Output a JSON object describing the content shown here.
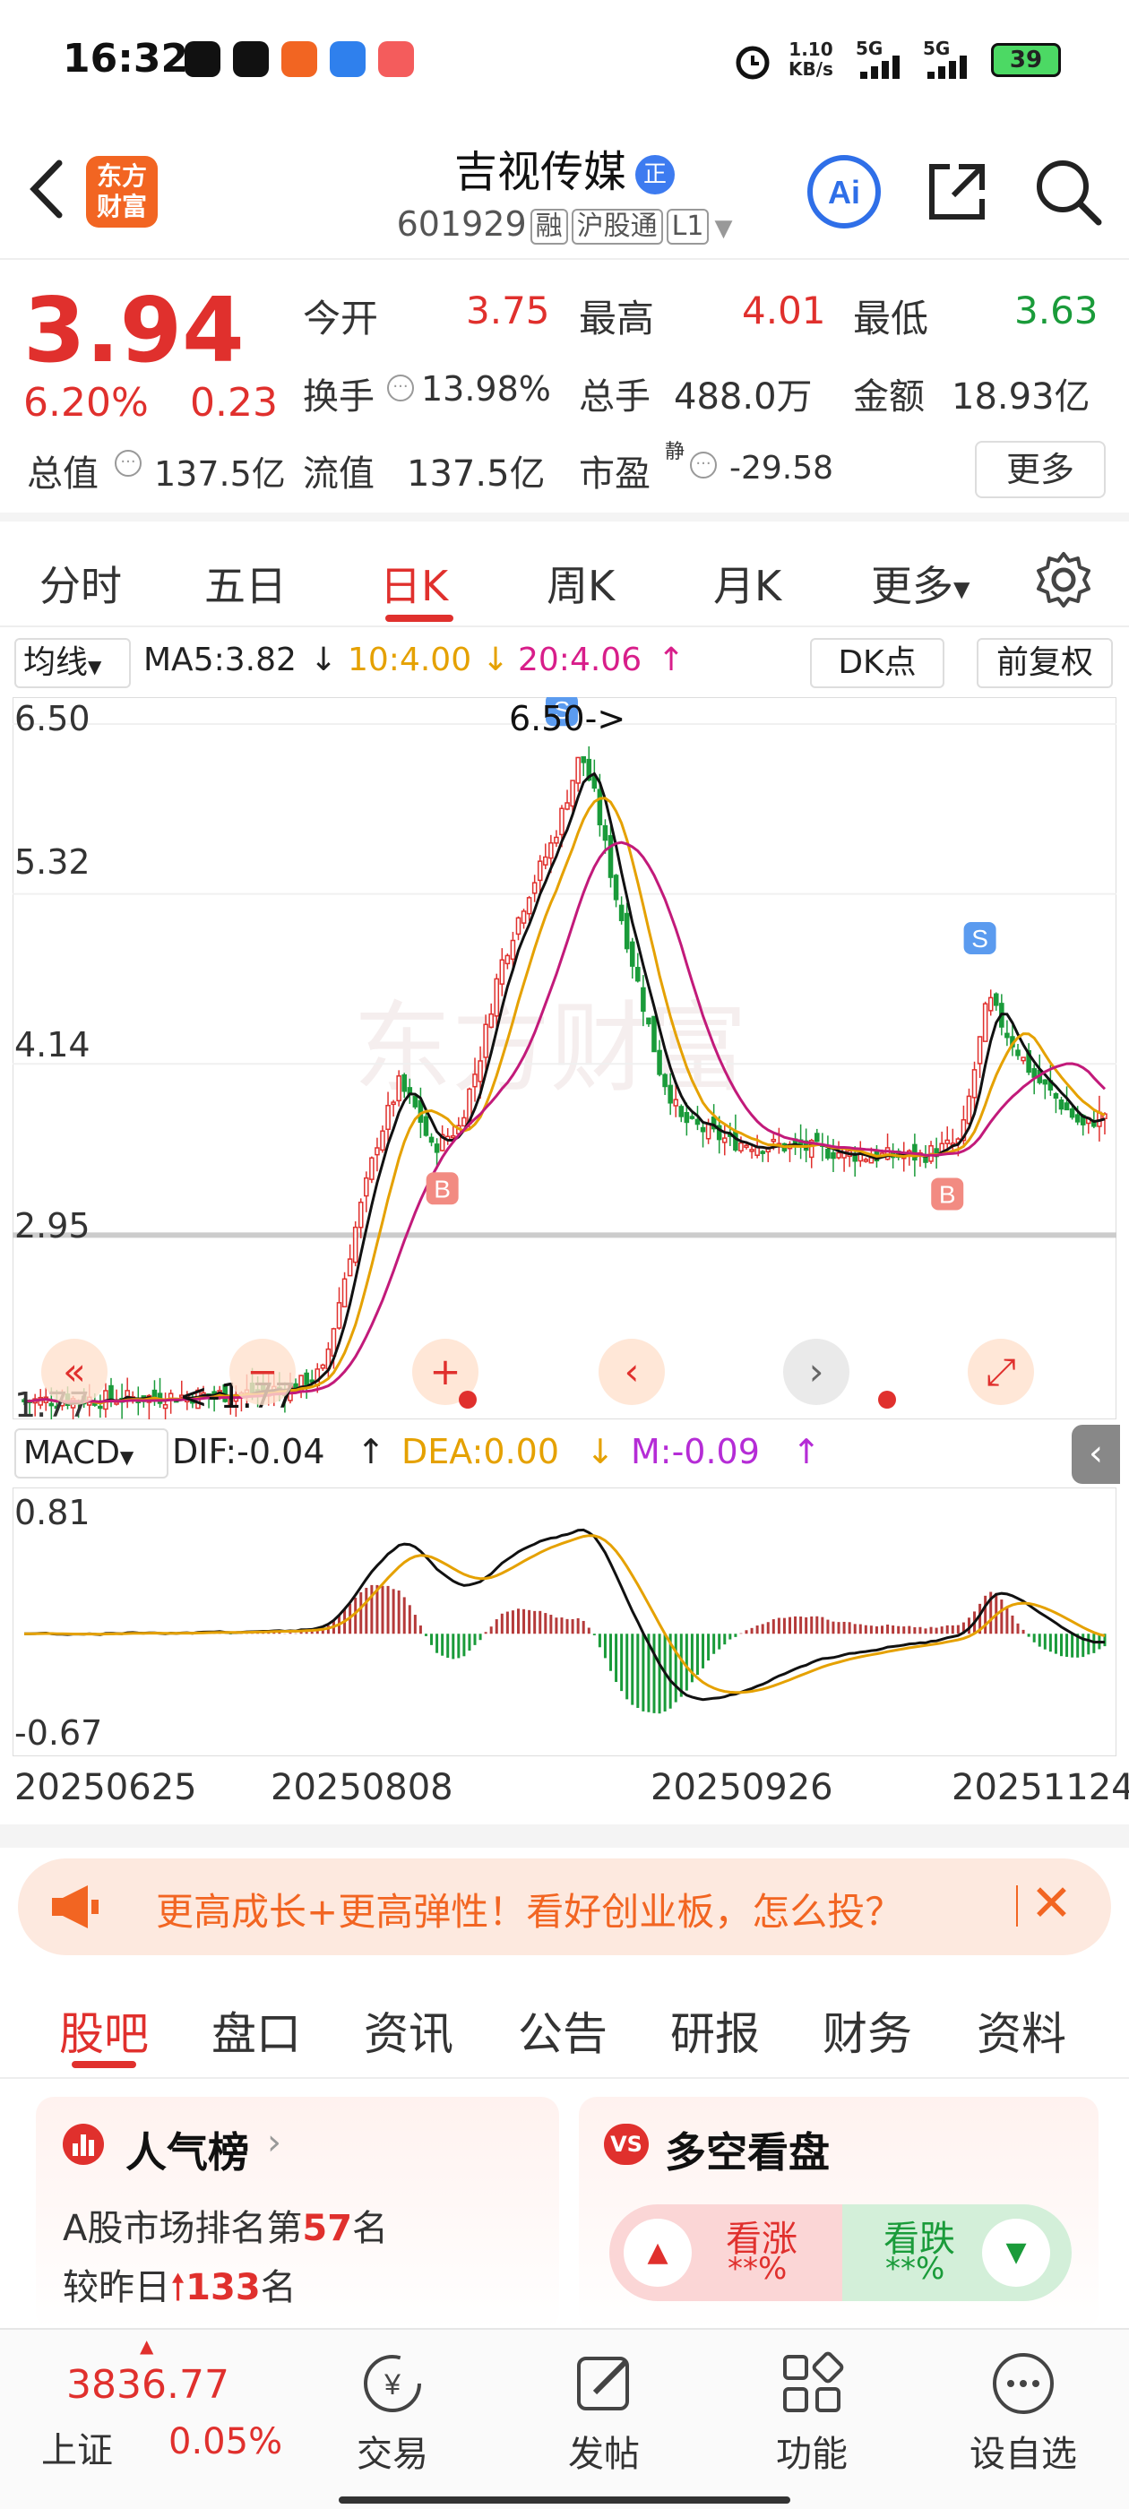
{
  "status_bar": {
    "time": "16:32",
    "net_speed": "1.10",
    "net_unit": "KB/s",
    "sig1": "5G",
    "sig2": "5G",
    "battery": "39"
  },
  "header": {
    "logo_line1": "东方",
    "logo_line2": "财富",
    "title": "吉视传媒",
    "title_badge": "正",
    "code": "601929",
    "tags": [
      "融",
      "沪股通",
      "L1"
    ]
  },
  "quote": {
    "price": "3.94",
    "change_pct": "6.20%",
    "change": "0.23",
    "open_label": "今开",
    "open": "3.75",
    "high_label": "最高",
    "high": "4.01",
    "low_label": "最低",
    "low": "3.63",
    "turnover_label": "换手",
    "turnover": "13.98%",
    "volume_label": "总手",
    "volume": "488.0万",
    "amount_label": "金额",
    "amount": "18.93亿",
    "mktcap_label": "总值",
    "mktcap": "137.5亿",
    "float_label": "流值",
    "float": "137.5亿",
    "pe_label": "市盈",
    "pe_sup": "静",
    "pe": "-29.58",
    "more": "更多"
  },
  "tabs": [
    "分时",
    "五日",
    "日K",
    "周K",
    "月K",
    "更多"
  ],
  "active_tab": "日K",
  "ma_bar": {
    "selector": "均线",
    "ma5": "MA5:3.82",
    "ma10": "10:4.00",
    "ma20": "20:4.06",
    "dk": "DK点",
    "fq": "前复权"
  },
  "kline": {
    "y_labels": [
      "6.50",
      "5.32",
      "4.14",
      "2.95",
      "1.77"
    ],
    "peak_label": "6.50->",
    "low_label": "<-1.77",
    "watermark": "东方财富"
  },
  "macd_bar": {
    "selector": "MACD",
    "dif": "DIF:-0.04",
    "dea": "DEA:0.00",
    "m": "M:-0.09"
  },
  "macd": {
    "y_top": "0.81",
    "y_bottom": "-0.67"
  },
  "x_dates": [
    "20250625",
    "20250808",
    "20250926",
    "20251124"
  ],
  "chart_data": {
    "type": "candlestick",
    "ylim": [
      1.77,
      6.5
    ],
    "annotations": {
      "high": 6.5,
      "low": 1.77
    },
    "ma": {
      "MA5": 3.82,
      "MA10": 4.0,
      "MA20": 4.06
    },
    "macd": {
      "DIF": -0.04,
      "DEA": 0.0,
      "M": -0.09,
      "ylim": [
        -0.67,
        0.81
      ]
    },
    "x_ticks": [
      "20250625",
      "20250808",
      "20250926",
      "20251124"
    ]
  },
  "banner": {
    "text": "更高成长+更高弹性！看好创业板，怎么投？"
  },
  "bottom_tabs": [
    "股吧",
    "盘口",
    "资讯",
    "公告",
    "研报",
    "财务",
    "资料"
  ],
  "popularity": {
    "title": "人气榜",
    "line1_pre": "A股市场排名第",
    "rank": "57",
    "line1_post": "名",
    "line2_pre": "较昨日",
    "delta": "133",
    "line2_post": "名"
  },
  "vote": {
    "title": "多空看盘",
    "up": "看涨",
    "up_pct": "**%",
    "down": "看跌",
    "down_pct": "**%"
  },
  "nav": {
    "index_value": "3836.77",
    "index_name": "上证",
    "index_pct": "0.05%",
    "items": [
      "交易",
      "发帖",
      "功能",
      "设自选"
    ]
  }
}
